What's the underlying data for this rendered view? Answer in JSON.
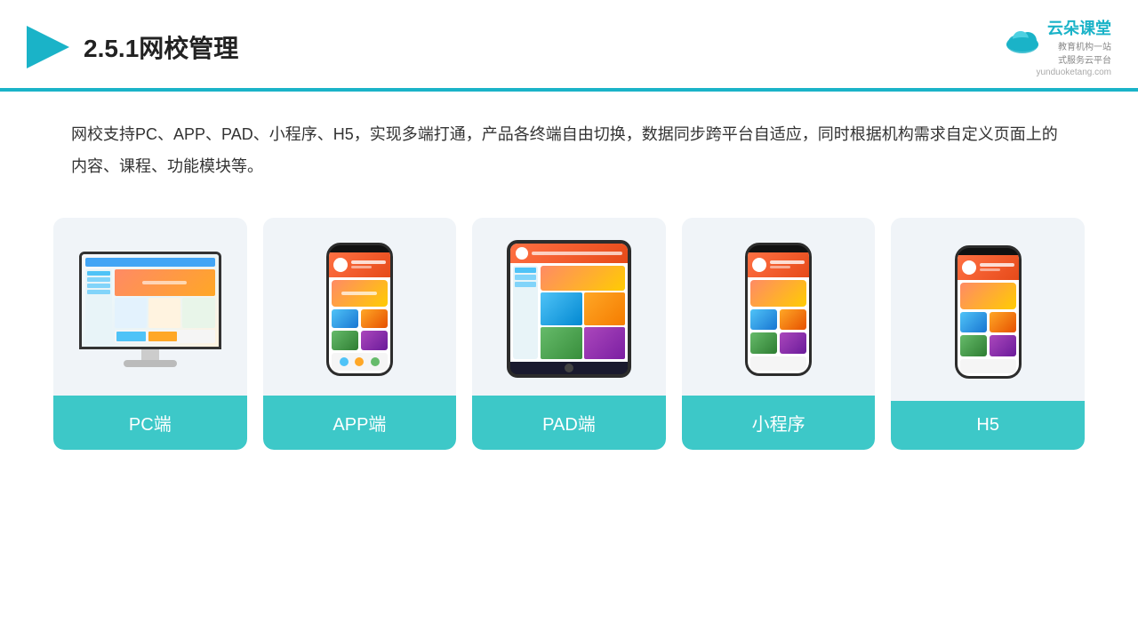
{
  "header": {
    "title": "2.5.1网校管理",
    "logo_name": "云朵课堂",
    "logo_url": "yunduoketang.com",
    "logo_tagline": "教育机构一站\n式服务云平台"
  },
  "description": {
    "text": "网校支持PC、APP、PAD、小程序、H5，实现多端打通，产品各终端自由切换，数据同步跨平台自适应，同时根据机构需求自定义页面上的内容、课程、功能模块等。"
  },
  "cards": [
    {
      "id": "pc",
      "label": "PC端"
    },
    {
      "id": "app",
      "label": "APP端"
    },
    {
      "id": "pad",
      "label": "PAD端"
    },
    {
      "id": "miniprogram",
      "label": "小程序"
    },
    {
      "id": "h5",
      "label": "H5"
    }
  ],
  "accent_color": "#3dc8c8",
  "border_color": "#1ab3c8"
}
